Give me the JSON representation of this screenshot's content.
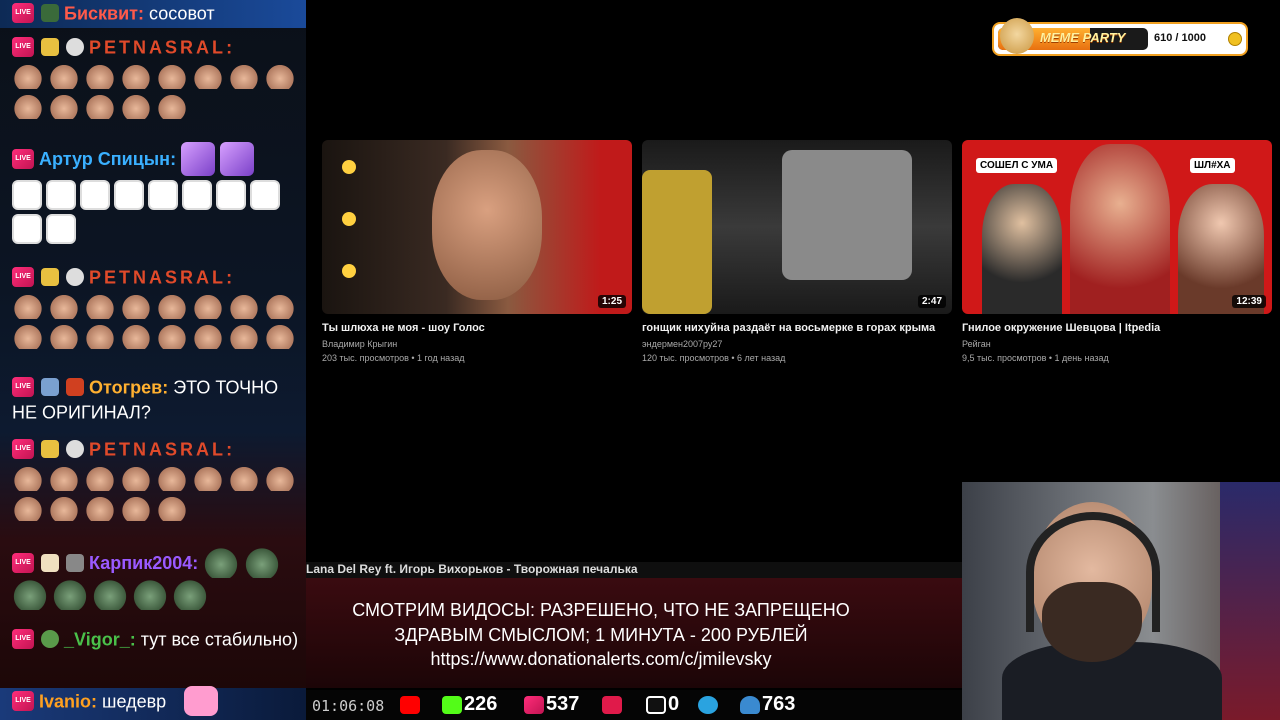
{
  "chat": {
    "messages": [
      {
        "user": "Бисквит",
        "text": "сосовот",
        "color": "#ff5a4a"
      },
      {
        "user": "PETNASRAL",
        "text": "",
        "color": "#e04a2a"
      },
      {
        "user": "Артур Спицын",
        "text": "",
        "color": "#3ab0ff"
      },
      {
        "user": "PETNASRAL",
        "text": "",
        "color": "#e04a2a"
      },
      {
        "user": "Отогрев",
        "text": "ЭТО ТОЧНО НЕ ОРИГИНАЛ?",
        "color": "#ffb030"
      },
      {
        "user": "PETNASRAL",
        "text": "",
        "color": "#e04a2a"
      },
      {
        "user": "Карпик2004",
        "text": "",
        "color": "#9a5aff"
      },
      {
        "user": "_Vigor_",
        "text": "тут все стабильно)",
        "color": "#4ac04a"
      },
      {
        "user": "Ivanio",
        "text": "шедевр",
        "color": "#ffa020"
      }
    ],
    "live_badge": "LIVE"
  },
  "videos": [
    {
      "title": "Ты шлюха не моя - шоу Голос",
      "channel": "Владимир Крыгин",
      "meta": "203 тыс. просмотров • 1 год назад",
      "duration": "1:25"
    },
    {
      "title": "гонщик нихуйна раздаёт на восьмерке в горах крыма",
      "channel": "эндермен2007ру27",
      "meta": "120 тыс. просмотров • 6 лет назад",
      "duration": "2:47"
    },
    {
      "title": "Гнилое окружение Шевцова | Itpedia",
      "channel": "Рейган",
      "meta": "9,5 тыс. просмотров • 1 день назад",
      "duration": "12:39"
    }
  ],
  "thumb3_labels": {
    "left": "СОШЕЛ С УМА",
    "right": "ШЛ#ХА"
  },
  "meme_party": {
    "label": "MEME PARTY",
    "count": "610 / 1000",
    "progress": 0.61
  },
  "now_playing": "Lana Del Rey ft. Игорь Вихорьков - Творожная печалька",
  "banner": {
    "line1": "СМОТРИМ ВИДОСЫ: РАЗРЕШЕНО, ЧТО НЕ ЗАПРЕЩЕНО",
    "line2": "ЗДРАВЫМ СМЫСЛОМ; 1 МИНУТА - 200 РУБЛЕЙ",
    "line3": "https://www.donationalerts.com/c/jmilevsky"
  },
  "status": {
    "uptime": "01:06:08",
    "kick": "226",
    "vk": "537",
    "rutube": "0",
    "viewers": "763"
  }
}
